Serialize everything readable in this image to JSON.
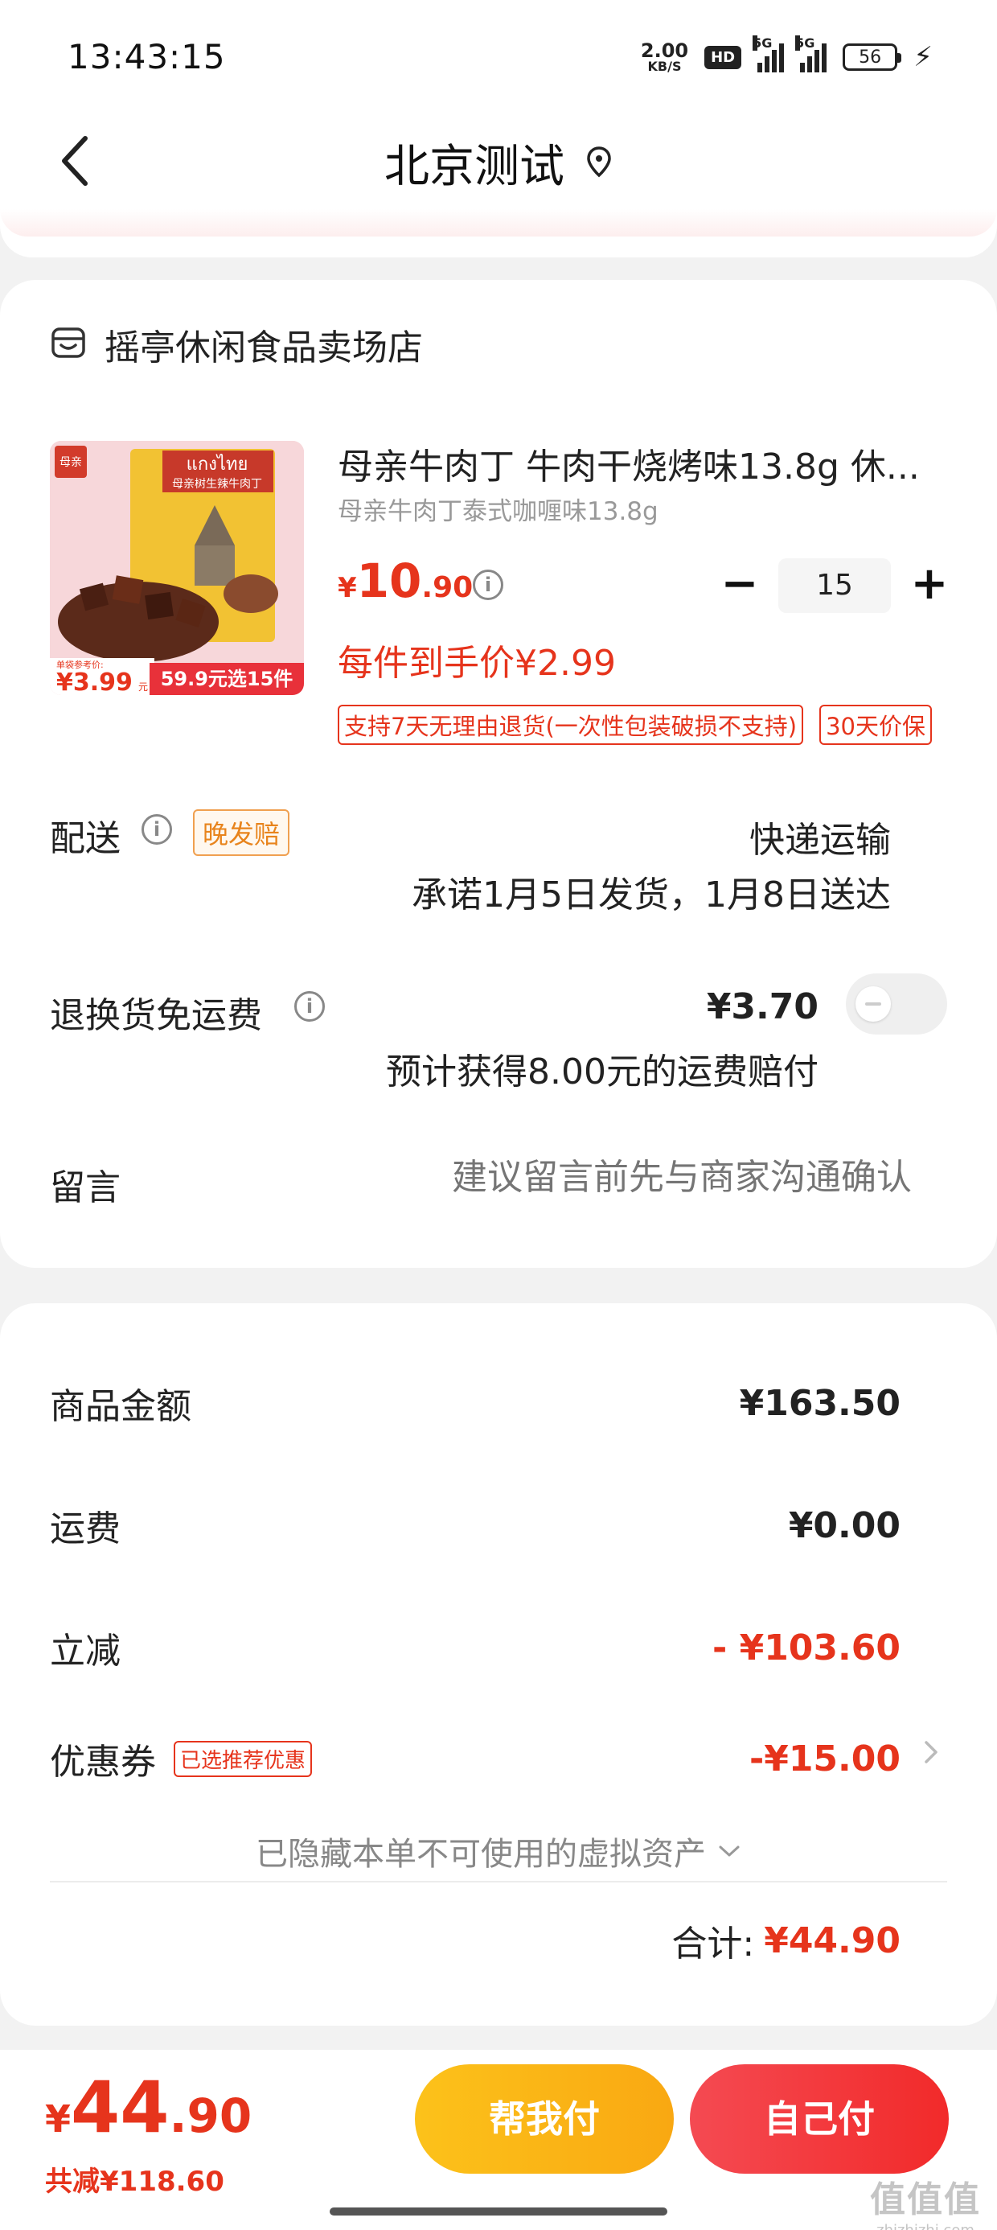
{
  "status_bar": {
    "time": "13:43:15",
    "net_speed": "2.00",
    "net_unit": "KB/S",
    "hd": "HD",
    "sig1": "5G",
    "sig2": "5G",
    "battery": "56"
  },
  "nav": {
    "title": "北京测试"
  },
  "store": {
    "name": "摇亭休闲食品卖场店"
  },
  "product": {
    "title": "母亲牛肉丁 牛肉干烧烤味13.8g 休...",
    "sku": "母亲牛肉丁泰式咖喱味13.8g",
    "price_symbol": "¥",
    "price_int": "10",
    "price_dec": ".90",
    "quantity": "15",
    "unit_price": "每件到手价¥2.99",
    "tags": [
      "支持7天无理由退货(一次性包装破损不支持)",
      "30天价保"
    ],
    "image": {
      "brand": "母亲",
      "banner_title": "แกงไทย",
      "banner_sub": "母亲树生辣牛肉丁",
      "ref_label": "单袋参考价:",
      "ref_price": "¥3.99",
      "ref_unit": "元",
      "promo": "59.9元选15件"
    }
  },
  "delivery": {
    "label": "配送",
    "badge": "晚发赔",
    "method": "快递运输",
    "promise": "承诺1月5日发货，1月8日送达"
  },
  "return_shipping": {
    "label": "退换货免运费",
    "price": "¥3.70",
    "compensation": "预计获得8.00元的运费赔付"
  },
  "memo": {
    "label": "留言",
    "placeholder": "建议留言前先与商家沟通确认"
  },
  "summary": {
    "goods_label": "商品金额",
    "goods_value": "¥163.50",
    "shipping_label": "运费",
    "shipping_value": "¥0.00",
    "discount_label": "立减",
    "discount_value": "- ¥103.60",
    "coupon_label": "优惠券",
    "coupon_badge": "已选推荐优惠",
    "coupon_value": "-¥15.00",
    "hidden_assets": "已隐藏本单不可使用的虚拟资产",
    "total_label": "合计:",
    "total_value": "¥44.90"
  },
  "bottom": {
    "price_symbol": "¥",
    "price_int": "44",
    "price_dec": ".90",
    "saved": "共减¥118.60",
    "help_pay": "帮我付",
    "self_pay": "自己付",
    "watermark": "值值值",
    "watermark_url": "zhizhizhi.com"
  },
  "colors": {
    "accent_red": "#e6341c",
    "yellow_button": "#fcc21a",
    "red_button": "#f22a2a"
  }
}
